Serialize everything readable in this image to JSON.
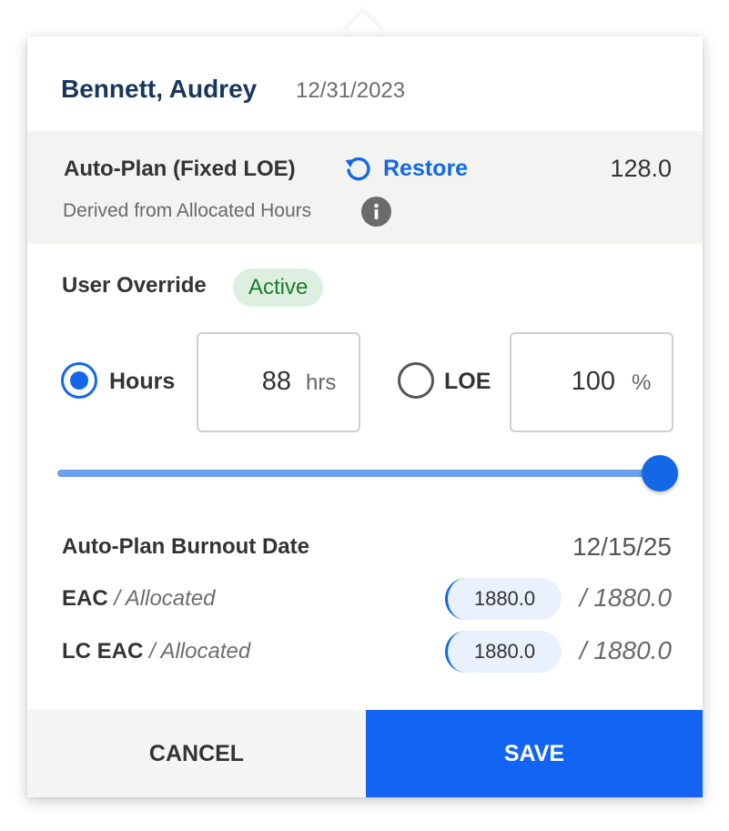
{
  "header": {
    "name": "Bennett, Audrey",
    "date": "12/31/2023"
  },
  "auto_plan": {
    "title": "Auto-Plan (Fixed LOE)",
    "restore_label": "Restore",
    "value": "128.0",
    "subtitle": "Derived from Allocated Hours",
    "restore_icon": "restore-icon",
    "info_icon": "info-icon"
  },
  "override": {
    "label": "User Override",
    "status": "Active",
    "hours_label": "Hours",
    "hours_selected": true,
    "hours_value": "88",
    "hours_unit": "hrs",
    "loe_label": "LOE",
    "loe_selected": false,
    "loe_value": "100",
    "loe_unit": "%",
    "slider_percent": 100
  },
  "summary": {
    "burnout_label": "Auto-Plan Burnout Date",
    "burnout_value": "12/15/25",
    "eac_label": "EAC",
    "eac_sub": "/ Allocated",
    "eac_value": "1880.0",
    "eac_allocated": "/ 1880.0",
    "lc_eac_label": "LC EAC",
    "lc_eac_sub": "/ Allocated",
    "lc_eac_value": "1880.0",
    "lc_eac_allocated": "/ 1880.0"
  },
  "footer": {
    "cancel_label": "CANCEL",
    "save_label": "SAVE"
  },
  "colors": {
    "accent": "#1468e6",
    "name": "#17365d",
    "badge_bg": "#dcefe0",
    "badge_text": "#1c7a2e"
  }
}
